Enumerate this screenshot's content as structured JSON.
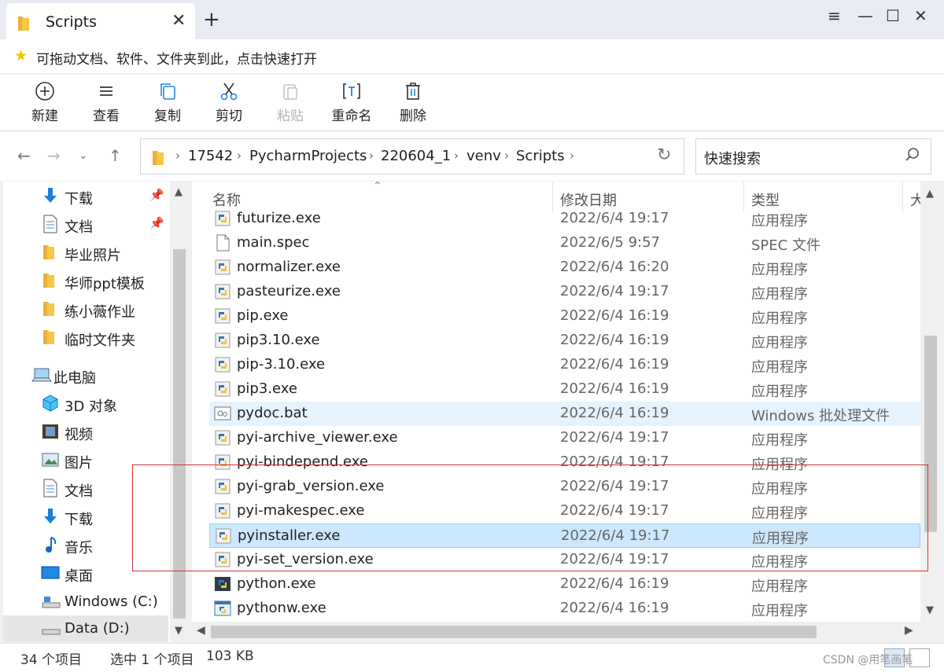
{
  "window": {
    "tab_title": "Scripts",
    "tab_close": "✕",
    "new_tab": "+",
    "menu_icon": "≡",
    "minimize": "—",
    "maximize": "☐",
    "close": "✕"
  },
  "hint": {
    "text": "可拖动文档、软件、文件夹到此，点击快速打开"
  },
  "toolbar": {
    "new": "新建",
    "view": "查看",
    "copy": "复制",
    "cut": "剪切",
    "paste": "粘贴",
    "rename": "重命名",
    "delete": "删除"
  },
  "address": {
    "crumbs": [
      "17542",
      "PycharmProjects",
      "220604_1",
      "venv",
      "Scripts"
    ],
    "search_placeholder": "快速搜索"
  },
  "sidebar": {
    "items": [
      {
        "label": "下载",
        "icon": "download-icon",
        "pinned": true
      },
      {
        "label": "文档",
        "icon": "document-icon",
        "pinned": true
      },
      {
        "label": "毕业照片",
        "icon": "folder-icon"
      },
      {
        "label": "华师ppt模板",
        "icon": "folder-icon"
      },
      {
        "label": "练小薇作业",
        "icon": "folder-icon"
      },
      {
        "label": "临时文件夹",
        "icon": "folder-icon"
      },
      {
        "label": "此电脑",
        "icon": "computer-icon"
      },
      {
        "label": "3D 对象",
        "icon": "3d-objects-icon"
      },
      {
        "label": "视频",
        "icon": "video-icon"
      },
      {
        "label": "图片",
        "icon": "pictures-icon"
      },
      {
        "label": "文档",
        "icon": "document-icon"
      },
      {
        "label": "下载",
        "icon": "download-icon"
      },
      {
        "label": "音乐",
        "icon": "music-icon"
      },
      {
        "label": "桌面",
        "icon": "desktop-icon"
      },
      {
        "label": "Windows (C:)",
        "icon": "drive-icon"
      },
      {
        "label": "Data (D:)",
        "icon": "drive-icon",
        "selected": true
      }
    ]
  },
  "columns": {
    "name": "名称",
    "date": "修改日期",
    "type": "类型",
    "size": "大"
  },
  "files": [
    {
      "name": "futurize.exe",
      "date": "2022/6/4 19:17",
      "type": "应用程序",
      "icon": "python-exe-icon"
    },
    {
      "name": "main.spec",
      "date": "2022/6/5 9:57",
      "type": "SPEC 文件",
      "icon": "blank-file-icon"
    },
    {
      "name": "normalizer.exe",
      "date": "2022/6/4 16:20",
      "type": "应用程序",
      "icon": "python-exe-icon"
    },
    {
      "name": "pasteurize.exe",
      "date": "2022/6/4 19:17",
      "type": "应用程序",
      "icon": "python-exe-icon"
    },
    {
      "name": "pip.exe",
      "date": "2022/6/4 16:19",
      "type": "应用程序",
      "icon": "python-exe-icon"
    },
    {
      "name": "pip3.10.exe",
      "date": "2022/6/4 16:19",
      "type": "应用程序",
      "icon": "python-exe-icon"
    },
    {
      "name": "pip-3.10.exe",
      "date": "2022/6/4 16:19",
      "type": "应用程序",
      "icon": "python-exe-icon"
    },
    {
      "name": "pip3.exe",
      "date": "2022/6/4 16:19",
      "type": "应用程序",
      "icon": "python-exe-icon"
    },
    {
      "name": "pydoc.bat",
      "date": "2022/6/4 16:19",
      "type": "Windows 批处理文件",
      "icon": "batch-file-icon",
      "hover": true
    },
    {
      "name": "pyi-archive_viewer.exe",
      "date": "2022/6/4 19:17",
      "type": "应用程序",
      "icon": "python-exe-icon"
    },
    {
      "name": "pyi-bindepend.exe",
      "date": "2022/6/4 19:17",
      "type": "应用程序",
      "icon": "python-exe-icon"
    },
    {
      "name": "pyi-grab_version.exe",
      "date": "2022/6/4 19:17",
      "type": "应用程序",
      "icon": "python-exe-icon"
    },
    {
      "name": "pyi-makespec.exe",
      "date": "2022/6/4 19:17",
      "type": "应用程序",
      "icon": "python-exe-icon"
    },
    {
      "name": "pyinstaller.exe",
      "date": "2022/6/4 19:17",
      "type": "应用程序",
      "icon": "python-exe-icon",
      "selected": true
    },
    {
      "name": "pyi-set_version.exe",
      "date": "2022/6/4 19:17",
      "type": "应用程序",
      "icon": "python-exe-icon"
    },
    {
      "name": "python.exe",
      "date": "2022/6/4 16:19",
      "type": "应用程序",
      "icon": "python-console-icon"
    },
    {
      "name": "pythonw.exe",
      "date": "2022/6/4 16:19",
      "type": "应用程序",
      "icon": "python-window-icon"
    }
  ],
  "status": {
    "count": "34 个项目",
    "selected": "选中 1 个项目",
    "size": "103 KB",
    "watermark": "CSDN @用笔画笔"
  },
  "colors": {
    "accent": "#0078d7",
    "selected_row": "#cce8ff",
    "hover_row": "#e5f3ff",
    "highlight_box": "#d93030",
    "folder": "#f8c74a"
  }
}
